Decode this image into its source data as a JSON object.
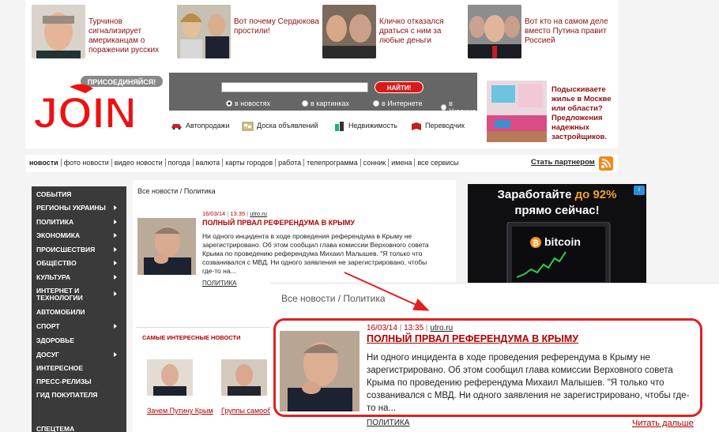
{
  "teasers": [
    {
      "text": "Турчинов сигнализирует американцам о поражении русских"
    },
    {
      "text": "Вот почему Сердюкова простили!"
    },
    {
      "text": "Кличко отказался драться с ним за любые деньги"
    },
    {
      "text": "Вот кто на самом деле вместо Путина правит Россией"
    }
  ],
  "header": {
    "logo_join_text": "ПРИСОЕДИНЯЙСЯ!",
    "logo_text": "JOIN",
    "search": {
      "input_value": "",
      "button_label": "НАЙТИ!",
      "options": [
        "в новостях",
        "в картинках",
        "в Интернете",
        "в Украине"
      ],
      "selected_index": 0
    },
    "services": [
      "Автопродажи",
      "Доска объявлений",
      "Недвижимость",
      "Переводчик"
    ],
    "right_ad_text": "Подыскиваете жилье в Москве или области? Предложения надежных застройщиков."
  },
  "nav": {
    "items": [
      "новости",
      "фото новости",
      "видео новости",
      "погода",
      "валюта",
      "карты городов",
      "работа",
      "телепрограмма",
      "сонник",
      "имена",
      "все сервисы"
    ],
    "partner_label": "Стать партнером"
  },
  "sidebar": {
    "items": [
      {
        "label": "СОБЫТИЯ",
        "arrow": false
      },
      {
        "label": "РЕГИОНЫ УКРАИНЫ",
        "arrow": true
      },
      {
        "label": "ПОЛИТИКА",
        "arrow": true
      },
      {
        "label": "ЭКОНОМИКА",
        "arrow": true
      },
      {
        "label": "ПРОИСШЕСТВИЯ",
        "arrow": true
      },
      {
        "label": "ОБЩЕСТВО",
        "arrow": true
      },
      {
        "label": "КУЛЬТУРА",
        "arrow": true
      },
      {
        "label": "ИНТЕРНЕТ И ТЕХНОЛОГИИ",
        "arrow": true
      },
      {
        "label": "АВТОМОБИЛИ",
        "arrow": false
      },
      {
        "label": "СПОРТ",
        "arrow": true
      },
      {
        "label": "ЗДОРОВЬЕ",
        "arrow": false
      },
      {
        "label": "ДОСУГ",
        "arrow": true
      },
      {
        "label": "ИНТЕРЕСНОЕ",
        "arrow": false
      },
      {
        "label": "ПРЕСС-РЕЛИЗЫ",
        "arrow": false
      },
      {
        "label": "ГИД ПОКУПАТЕЛЯ",
        "arrow": false
      },
      {
        "label": "СПЕЦТЕМА",
        "arrow": false
      }
    ]
  },
  "main": {
    "breadcrumb": "Все новости / Политика",
    "article": {
      "date": "16/03/14",
      "time": "13:35",
      "source": "utro.ru",
      "title": "ПОЛНЫЙ ПРВАЛ РЕФЕРЕНДУМА В КРЫМУ",
      "body": "Ни одного инцидента в ходе проведения референдума в Крыму не зарегистрировано. Об этом сообщил глава комиссии Верховного совета Крыма по проведению референдума Михаил Малышев. \"Я только что созванивался с МВД. Ни одного заявления не зарегистрировано, чтобы где-то на...",
      "tag": "ПОЛИТИКА",
      "more_label": "Читать дальше"
    },
    "interesting_title": "САМЫЕ ИНТЕРЕСНЫЕ НОВОСТИ",
    "interesting": [
      {
        "caption": "Зачем Путину Крым"
      },
      {
        "caption": "Группы самооб на Украине обра"
      }
    ]
  },
  "bitcoin_ad": {
    "line1_pre": "Заработайте ",
    "line1_highlight": "до 92%",
    "line2": "прямо сейчас!",
    "brand": "bitcoin",
    "info_label": "i"
  },
  "colors": {
    "accent_red": "#b00000",
    "sidebar_bg": "#3a3a3a",
    "search_bg": "#666666",
    "frame_red": "#e02020"
  }
}
